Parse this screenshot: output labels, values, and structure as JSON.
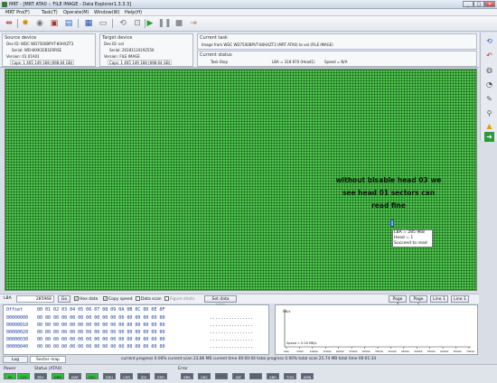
{
  "window": {
    "title": "MRT - [MRT ATA0 :: FILE IMAGE - Data Explorer1.3.3.3]",
    "buttons": [
      "_",
      "□",
      "✕"
    ]
  },
  "menu": [
    "MRT Pro(F)",
    "Task(T)",
    "Operate(M)",
    "Window(W)",
    "Help(H)"
  ],
  "source_device": {
    "header": "Source device",
    "dev_id": "Dev ID: WDC WD7500BPVT-80HXZT3",
    "serial": "Serial: WD-WXK1EB1ERRSE",
    "version": "Version: 01.01A01",
    "caps": "Caps: 1 465 149 168 (698.64 GB)"
  },
  "target_device": {
    "header": "Target device",
    "dev_id": "Dev ID: vol",
    "serial": "Serial: 20181124192556",
    "version": "Version: FILE IMAGE",
    "caps": "Caps: 1 465 149 168 (698.64 GB)"
  },
  "current_task": {
    "header": "Current task",
    "text": "Image from WDC WD7500BPVT-80HXZT3 (MRT ATA0) to vol (FILE IMAGE)"
  },
  "current_status": {
    "header": "Current status",
    "task": "Task Stop",
    "lba": "LBA = 318 870 (Head1)",
    "speed": "Speed = N/A"
  },
  "annotation": {
    "line1": "without bisable head 03 we",
    "line2": "see head 01 sectors  can",
    "line3": "read fine"
  },
  "tooltip": {
    "lba": "LBA = 285 968",
    "head": "Head = 1",
    "status": "Succeed to read"
  },
  "controls": {
    "lba_label": "LBA",
    "lba_value": "285968",
    "go": "Go",
    "hex_data": "Hex data",
    "copy_speed": "Copy speed",
    "data_scan": "Data scan",
    "figure_shots": "Figure shots",
    "set_data_scan": "Set data scan",
    "page7": "Page 7",
    "page1": "Page 1",
    "line1": "Line 1",
    "line1b": "Line 1"
  },
  "hex": {
    "header_offset": "Offset",
    "header_bytes": "00 01 02 03 04 05 06 07 08 09 0A 0B 0C 0D 0E 0F",
    "rows": [
      {
        "offset": "00000000",
        "bytes": "00 00 00 00 00 00 00 00 00 00 00 00 00 00 00 00",
        "ascii": "................"
      },
      {
        "offset": "00000010",
        "bytes": "00 00 00 00 00 00 00 00 00 00 00 00 00 00 00 00",
        "ascii": "................"
      },
      {
        "offset": "00000020",
        "bytes": "00 00 00 00 00 00 00 00 00 00 00 00 00 00 00 00",
        "ascii": "................"
      },
      {
        "offset": "00000030",
        "bytes": "00 00 00 00 00 00 00 00 00 00 00 00 00 00 00 00",
        "ascii": "................"
      },
      {
        "offset": "00000040",
        "bytes": "00 00 00 00 00 00 00 00 00 00 00 00 00 00 00 00",
        "ascii": "................"
      }
    ]
  },
  "graph": {
    "y_label": "MB/s",
    "speed_label": "Speed = 0.00 MB/s",
    "x_ticks": [
      "0Gb",
      "50Gb",
      "100Gb",
      "150Gb",
      "200Gb",
      "250Gb",
      "300Gb",
      "350Gb",
      "400Gb",
      "450Gb",
      "500Gb",
      "550Gb",
      "600Gb",
      "650Gb",
      "700Gb"
    ]
  },
  "tabs": {
    "log": "Log",
    "sector_map": "Sector map"
  },
  "status": {
    "current_progress": "current progress 0.00% current scan  23.86 MB  current time  00:00:04   total progress 0.00% total scan 25.74 MB total time 00:01:34"
  },
  "leds": {
    "power_label": "Power",
    "power": [
      {
        "label": "5V",
        "on": true
      },
      {
        "label": "12V",
        "on": true
      }
    ],
    "status_label": "Status (ATA0)",
    "status": [
      {
        "label": "BSY",
        "on": false
      },
      {
        "label": "DRD",
        "on": true
      },
      {
        "label": "DWF",
        "on": false
      },
      {
        "label": "DSC",
        "on": true
      },
      {
        "label": "DRQ",
        "on": false
      },
      {
        "label": "CRR",
        "on": false
      },
      {
        "label": "IDX",
        "on": false
      },
      {
        "label": "ERR",
        "on": false
      }
    ],
    "error_label": "Error",
    "error": [
      {
        "label": "BBK",
        "on": false
      },
      {
        "label": "UNC",
        "on": false
      },
      {
        "label": "",
        "on": false
      },
      {
        "label": "INF",
        "on": false
      },
      {
        "label": "",
        "on": false
      },
      {
        "label": "ABR",
        "on": false
      },
      {
        "label": "TON",
        "on": false
      },
      {
        "label": "AMN",
        "on": false
      }
    ]
  }
}
